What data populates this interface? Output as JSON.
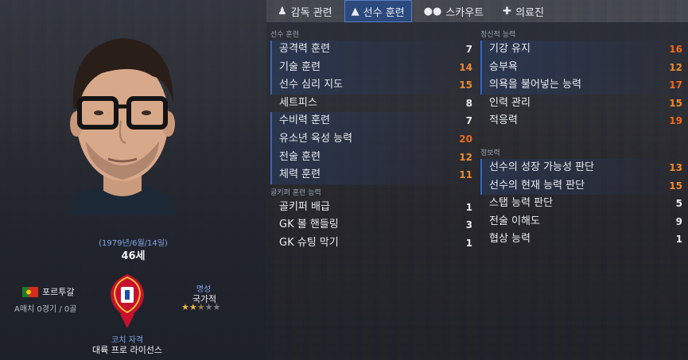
{
  "tabs": [
    {
      "label": "감독 관련",
      "icon": "manager-icon",
      "active": false
    },
    {
      "label": "선수 훈련",
      "icon": "training-icon",
      "active": true
    },
    {
      "label": "스카우트",
      "icon": "binoculars-icon",
      "active": false
    },
    {
      "label": "의료진",
      "icon": "medical-kit-icon",
      "active": false
    }
  ],
  "profile": {
    "dob": "(1979년/6월/14일)",
    "age": "46세",
    "nation": "포르투갈",
    "stats": "A매치 0경기 / 0골",
    "reputation_label": "명성",
    "reputation_value": "국가적",
    "reputation_stars": 2.5,
    "reputation_max": 5,
    "license_label": "코치 자격",
    "license_value": "대륙 프로 라이선스"
  },
  "colors": {
    "accent": "#2c4a7e",
    "link_blue": "#7fa6e8",
    "value_white": "#e9ecef",
    "value_yellow": "#e0c86a",
    "value_orange": "#f08a2c"
  },
  "coaching": {
    "title": "선수 훈련",
    "items": [
      {
        "label": "공격력 훈련",
        "value": "7"
      },
      {
        "label": "기술 훈련",
        "value": "14"
      },
      {
        "label": "선수 심리 지도",
        "value": "15"
      },
      {
        "label": "세트피스",
        "value": "8"
      },
      {
        "label": "수비력 훈련",
        "value": "7"
      },
      {
        "label": "유소년 육성 능력",
        "value": "20"
      },
      {
        "label": "전술 훈련",
        "value": "12"
      },
      {
        "label": "체력 훈련",
        "value": "11"
      }
    ]
  },
  "goalkeeping": {
    "title": "골키퍼 훈련 능력",
    "items": [
      {
        "label": "골키퍼 배급",
        "value": "1"
      },
      {
        "label": "GK 볼 핸들링",
        "value": "3"
      },
      {
        "label": "GK 슈팅 막기",
        "value": "1"
      }
    ]
  },
  "mental": {
    "title": "정신적 능력",
    "items": [
      {
        "label": "기강 유지",
        "value": "16"
      },
      {
        "label": "승부욕",
        "value": "12"
      },
      {
        "label": "의욕을 불어넣는 능력",
        "value": "17"
      },
      {
        "label": "인력 관리",
        "value": "15"
      },
      {
        "label": "적응력",
        "value": "19"
      }
    ]
  },
  "knowledge": {
    "title": "정보력",
    "items": [
      {
        "label": "선수의 성장 가능성 판단",
        "value": "13"
      },
      {
        "label": "선수의 현재 능력 판단",
        "value": "15"
      },
      {
        "label": "스탭 능력 판단",
        "value": "5"
      },
      {
        "label": "전술 이해도",
        "value": "9"
      },
      {
        "label": "협상 능력",
        "value": "1"
      }
    ]
  }
}
